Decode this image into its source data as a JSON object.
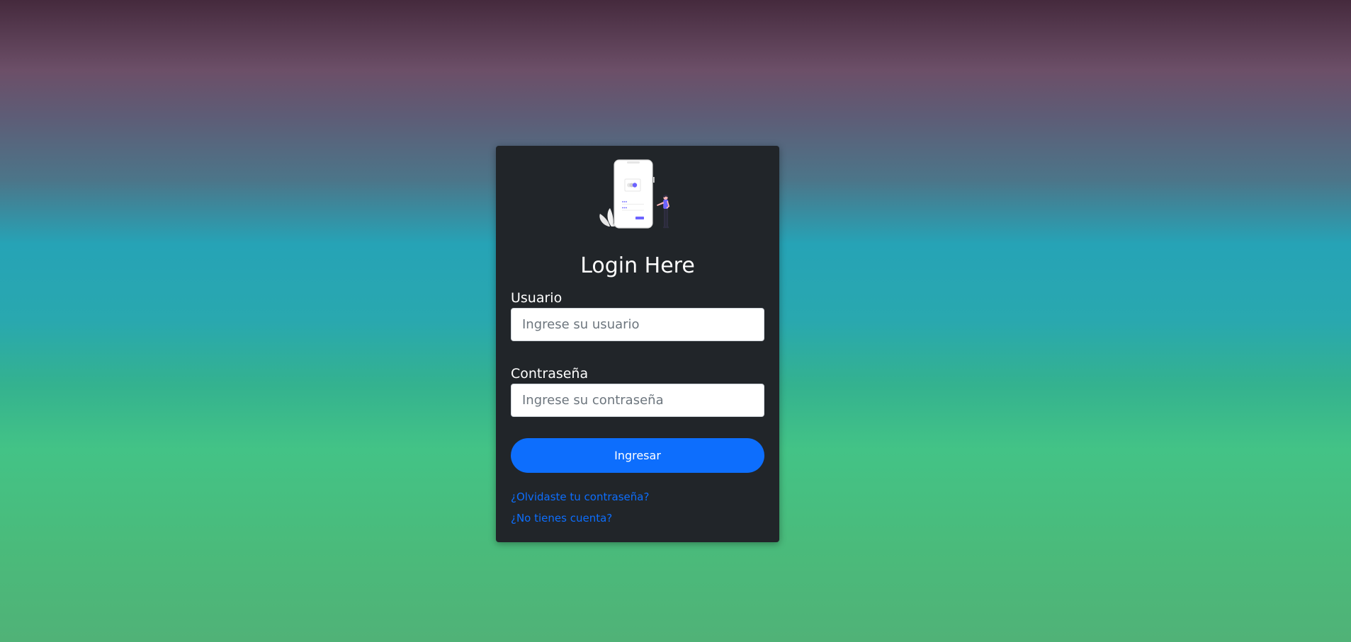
{
  "login": {
    "title": "Login Here",
    "username_label": "Usuario",
    "username_placeholder": "Ingrese su usuario",
    "password_label": "Contraseña",
    "password_placeholder": "Ingrese su contraseña",
    "submit_label": "Ingresar",
    "forgot_link": "¿Olvidaste tu contraseña?",
    "signup_link": "¿No tienes cuenta?"
  },
  "colors": {
    "card_background": "#212529",
    "button": "#0d6efd",
    "link": "#0d6efd",
    "illustration_accent": "#6c63ff"
  },
  "icons": {
    "illustration": "mobile-login-illustration"
  }
}
